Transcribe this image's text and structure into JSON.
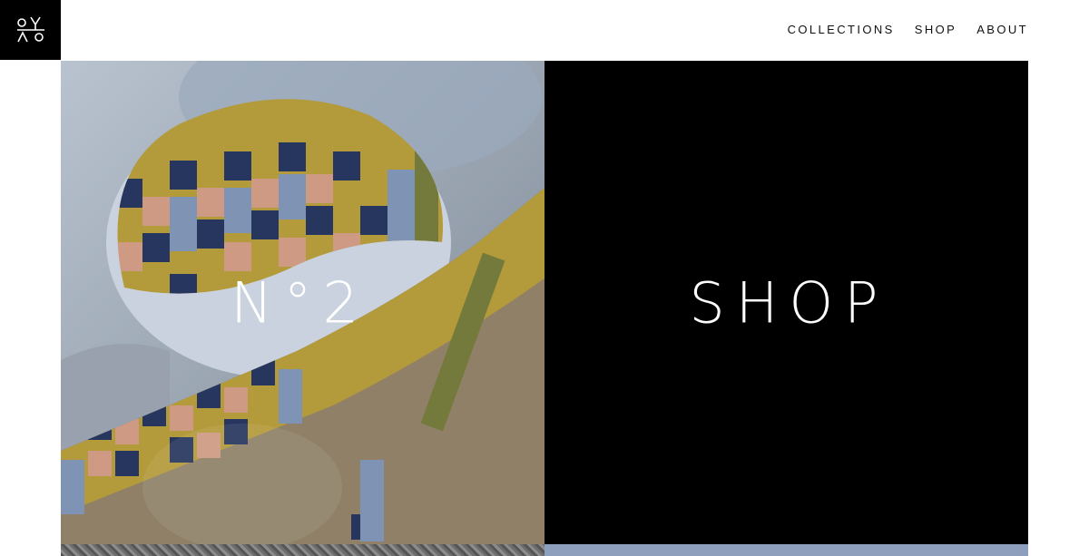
{
  "brand": {
    "logo_icon": "monogram-logo-icon"
  },
  "nav": {
    "items": [
      {
        "label": "COLLECTIONS"
      },
      {
        "label": "SHOP"
      },
      {
        "label": "ABOUT"
      }
    ]
  },
  "tiles": {
    "left": {
      "title": "N°2",
      "image": "woven-textile-photo"
    },
    "right": {
      "title": "SHOP",
      "background": "#000000"
    }
  },
  "colors": {
    "mustard": "#b39a3a",
    "navy": "#26365e",
    "denim": "#7f93b4",
    "peach": "#cf9a83",
    "olive": "#747a3c",
    "taupe": "#8f8067",
    "sky": "#aab6c6"
  }
}
